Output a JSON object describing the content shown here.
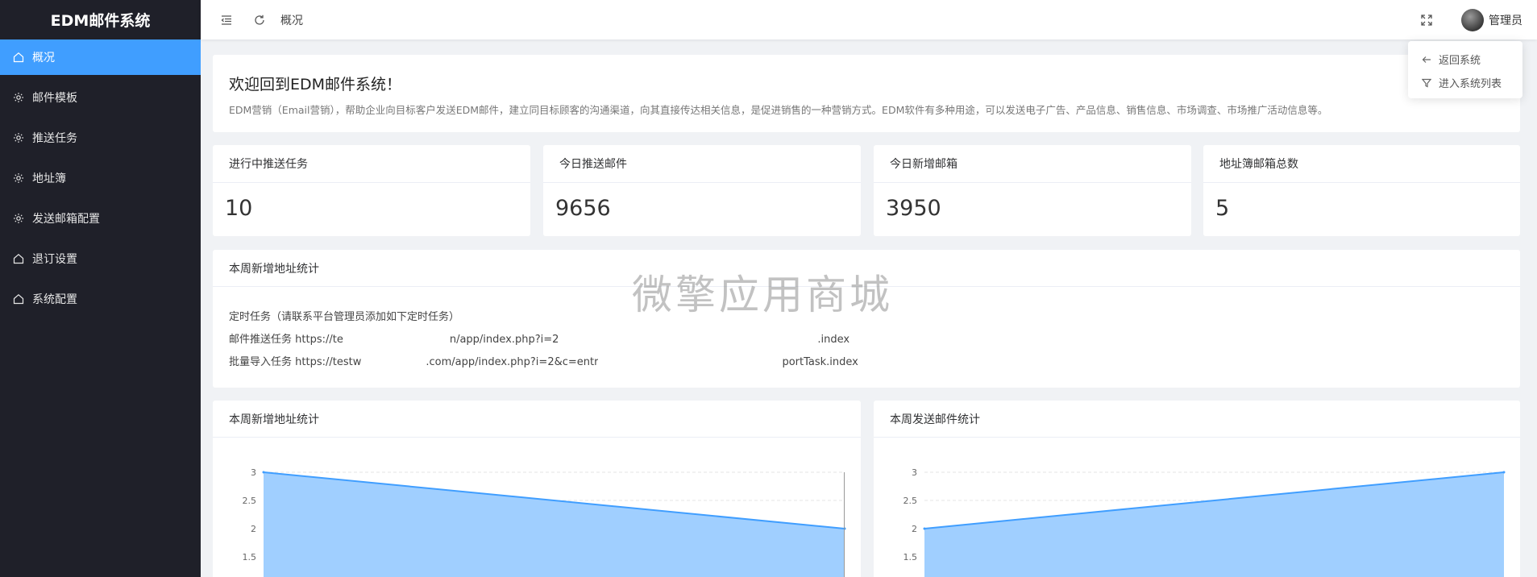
{
  "app": {
    "logo": "EDM邮件系统"
  },
  "sidebar": {
    "items": [
      {
        "label": "概况",
        "icon": "home-icon",
        "active": true
      },
      {
        "label": "邮件模板",
        "icon": "gear-icon",
        "active": false
      },
      {
        "label": "推送任务",
        "icon": "gear-icon",
        "active": false
      },
      {
        "label": "地址簿",
        "icon": "gear-icon",
        "active": false
      },
      {
        "label": "发送邮箱配置",
        "icon": "gear-icon",
        "active": false
      },
      {
        "label": "退订设置",
        "icon": "home-icon",
        "active": false
      },
      {
        "label": "系统配置",
        "icon": "home-icon",
        "active": false
      }
    ]
  },
  "header": {
    "breadcrumb": "概况",
    "user": "管理员"
  },
  "dropdown": {
    "items": [
      {
        "label": "返回系统",
        "icon": "arrow-left-icon"
      },
      {
        "label": "进入系统列表",
        "icon": "filter-icon"
      }
    ]
  },
  "welcome": {
    "title": "欢迎回到EDM邮件系统！",
    "desc": "EDM营销（Email营销），帮助企业向目标客户发送EDM邮件，建立同目标顾客的沟通渠道，向其直接传达相关信息，是促进销售的一种营销方式。EDM软件有多种用途，可以发送电子广告、产品信息、销售信息、市场调查、市场推广活动信息等。"
  },
  "stats": [
    {
      "label": "进行中推送任务",
      "value": "10"
    },
    {
      "label": "今日推送邮件",
      "value": "9656"
    },
    {
      "label": "今日新增邮箱",
      "value": "3950"
    },
    {
      "label": "地址簿邮箱总数",
      "value": "5"
    }
  ],
  "tasks": {
    "title": "本周新增地址统计",
    "intro": "定时任务（请联系平台管理员添加如下定时任务）",
    "line1_prefix": "邮件推送任务 https://te",
    "line1_mid": "n/app/index.php?i=2",
    "line1_suffix": ".index",
    "line2_prefix": "批量导入任务 https://testw",
    "line2_mid": ".com/app/index.php?i=2&c=entr",
    "line2_suffix": "portTask.index"
  },
  "watermark": "微擎应用商城",
  "charts": {
    "accent": "#409eff",
    "fill": "#a0cfff"
  },
  "chart_data": [
    {
      "type": "area",
      "title": "本周新增地址统计",
      "y_ticks": [
        "3",
        "2.5",
        "2",
        "1.5"
      ],
      "values": [
        3,
        2
      ],
      "ylim": [
        1.5,
        3
      ]
    },
    {
      "type": "area",
      "title": "本周发送邮件统计",
      "y_ticks": [
        "3",
        "2.5",
        "2",
        "1.5"
      ],
      "values": [
        2,
        3
      ],
      "ylim": [
        1.5,
        3
      ]
    }
  ]
}
